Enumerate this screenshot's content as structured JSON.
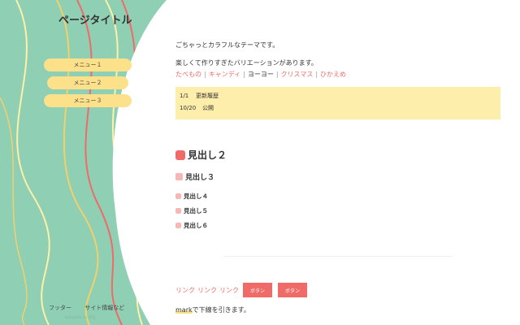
{
  "site": {
    "title": "ページタイトル"
  },
  "nav": {
    "items": [
      {
        "label": "メニュー１"
      },
      {
        "label": "メニュー２"
      },
      {
        "label": "メニュー３"
      }
    ]
  },
  "content": {
    "intro": "ごちゃっとカラフルなテーマです。",
    "line2": "楽しくて作りすぎたバリエーションがあります。",
    "themes": [
      "たべもの",
      "キャンディ",
      "ヨーヨー",
      "クリスマス",
      "ひかえめ"
    ],
    "updates": [
      {
        "date": "1/1",
        "text": "更新履歴"
      },
      {
        "date": "10/20",
        "text": "公開"
      }
    ],
    "h2": "見出し２",
    "h3": "見出し３",
    "h4": "見出し４",
    "h5": "見出し５",
    "h6": "見出し６",
    "links": [
      "リンク",
      "リンク",
      "リンク"
    ],
    "buttons": [
      "ボタン",
      "ボタン"
    ],
    "mark_word": "mark",
    "mark_rest": "で下線を引きます。"
  },
  "footer": {
    "links": [
      "フッター",
      "サイト情報など"
    ],
    "credit": "template by 青石"
  },
  "colors": {
    "accent": "#f06b68",
    "yellow": "#fde08a",
    "mint": "#8fcfb3",
    "notice_bg": "#fdeeab"
  }
}
